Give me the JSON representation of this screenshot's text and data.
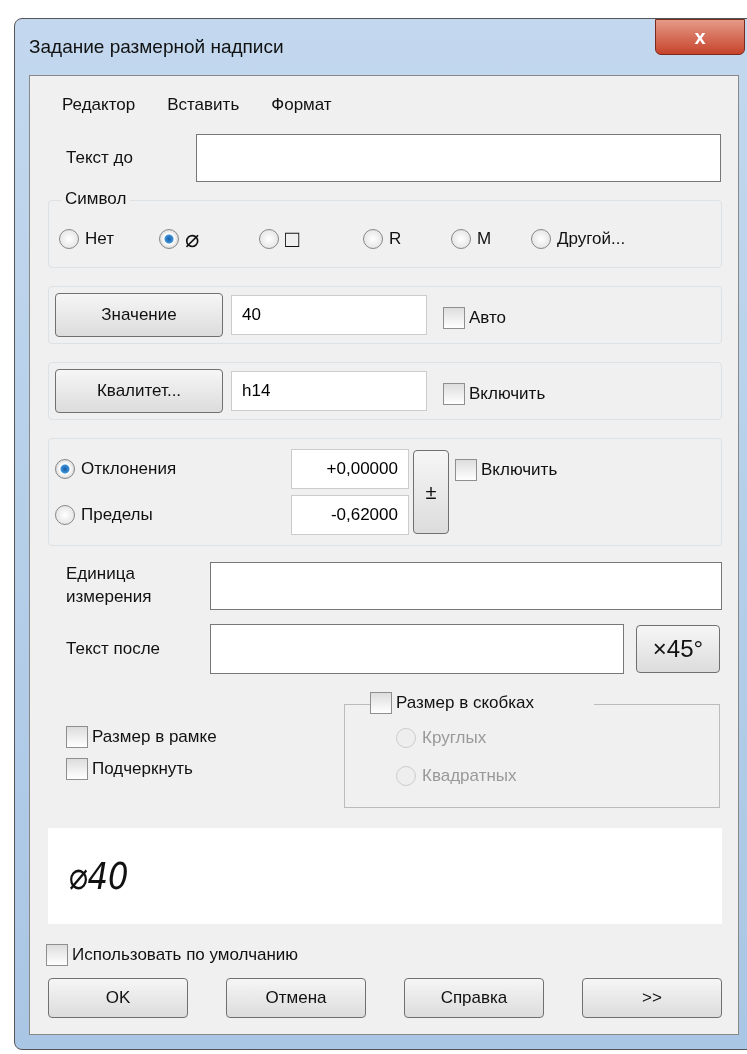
{
  "window": {
    "title": "Задание размерной надписи",
    "close": "x"
  },
  "menu": [
    "Редактор",
    "Вставить",
    "Формат"
  ],
  "text_before": {
    "label": "Текст до"
  },
  "symbol": {
    "title": "Символ",
    "options": [
      {
        "label": "Нет",
        "selected": false
      },
      {
        "label": "⌀",
        "selected": true
      },
      {
        "label": "□",
        "selected": false
      },
      {
        "label": "R",
        "selected": false
      },
      {
        "label": "M",
        "selected": false
      },
      {
        "label": "Другой...",
        "selected": false
      }
    ]
  },
  "value_row": {
    "button": "Значение",
    "value": "40",
    "checkbox": {
      "label": "Авто",
      "checked": false
    }
  },
  "quality_row": {
    "button": "Квалитет...",
    "value": "h14",
    "checkbox": {
      "label": "Включить",
      "checked": false
    }
  },
  "tolerance": {
    "options": [
      {
        "label": "Отклонения",
        "selected": true,
        "value": "+0,00000"
      },
      {
        "label": "Пределы",
        "selected": false,
        "value": "-0,62000"
      }
    ],
    "plusminus": "±",
    "checkbox": {
      "label": "Включить",
      "checked": false
    }
  },
  "unit": {
    "label": "Единица измерения"
  },
  "text_after": {
    "label": "Текст после",
    "button": "×45°"
  },
  "left_checks": [
    {
      "label": "Размер в рамке",
      "checked": false
    },
    {
      "label": "Подчеркнуть",
      "checked": false
    }
  ],
  "brackets": {
    "label": "Размер в скобках",
    "checked": false,
    "options": [
      {
        "label": "Круглых",
        "selected": false,
        "disabled": true
      },
      {
        "label": "Квадратных",
        "selected": false,
        "disabled": true
      }
    ]
  },
  "preview": "⌀40",
  "use_default": {
    "label": "Использовать по умолчанию",
    "checked": false
  },
  "buttons": [
    "OK",
    "Отмена",
    "Справка",
    ">>"
  ]
}
